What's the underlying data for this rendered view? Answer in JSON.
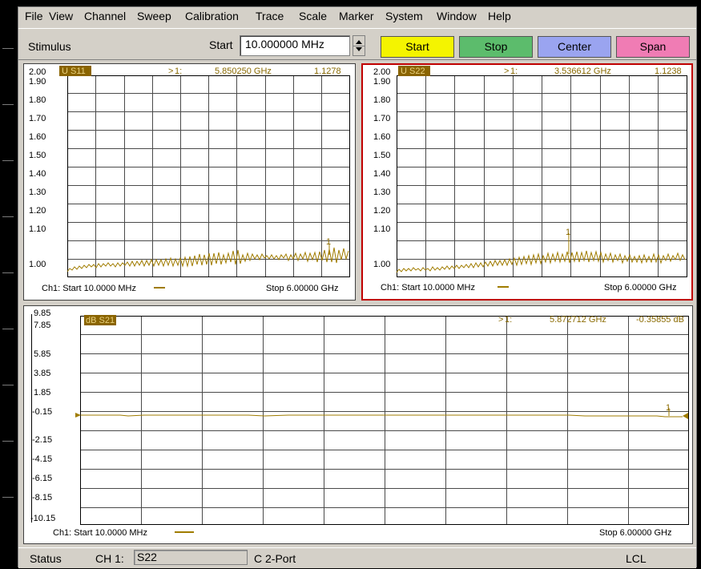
{
  "menu": [
    "File",
    "View",
    "Channel",
    "Sweep",
    "Calibration",
    "Trace",
    "Scale",
    "Marker",
    "System",
    "Window",
    "Help"
  ],
  "stimulus": {
    "label": "Stimulus",
    "start_label": "Start",
    "start_value": "10.000000 MHz",
    "buttons": [
      {
        "label": "Start",
        "color": "#f4f400"
      },
      {
        "label": "Stop",
        "color": "#5cbc6c"
      },
      {
        "label": "Center",
        "color": "#9aa4f0"
      },
      {
        "label": "Span",
        "color": "#f07cb4"
      }
    ]
  },
  "panels": [
    {
      "trace_badge": "U S11",
      "marker_prefix": ">",
      "marker_num": "1:",
      "marker_freq": "5.850250 GHz",
      "marker_value": "1.1278",
      "y_ticks": [
        "2.00",
        "1.90",
        "1.80",
        "1.70",
        "1.60",
        "1.50",
        "1.40",
        "1.30",
        "1.20",
        "1.10",
        "1.00"
      ],
      "footer_start": "Ch1: Start 10.0000 MHz",
      "footer_stop": "Stop 6.00000 GHz",
      "marker_label": "1"
    },
    {
      "trace_badge": "U S22",
      "marker_prefix": ">",
      "marker_num": "1:",
      "marker_freq": "3.536612 GHz",
      "marker_value": "1.1238",
      "y_ticks": [
        "2.00",
        "1.90",
        "1.80",
        "1.70",
        "1.60",
        "1.50",
        "1.40",
        "1.30",
        "1.20",
        "1.10",
        "1.00"
      ],
      "footer_start": "Ch1: Start 10.0000 MHz",
      "footer_stop": "Stop 6.00000 GHz",
      "marker_label": "1"
    },
    {
      "trace_badge": "dB S21",
      "marker_prefix": ">",
      "marker_num": "1:",
      "marker_freq": "5.872712 GHz",
      "marker_value": "-0.35855 dB",
      "y_ticks": [
        "9.85",
        "7.85",
        "5.85",
        "3.85",
        "1.85",
        "-0.15",
        "-2.15",
        "-4.15",
        "-6.15",
        "-8.15",
        "-10.15"
      ],
      "footer_start": "Ch1: Start 10.0000 MHz",
      "footer_stop": "Stop 6.00000 GHz",
      "marker_label": "1"
    }
  ],
  "status": {
    "label": "Status",
    "channel": "CH 1:",
    "trace": "S22",
    "cal": "C 2-Port",
    "mode": "LCL"
  }
}
